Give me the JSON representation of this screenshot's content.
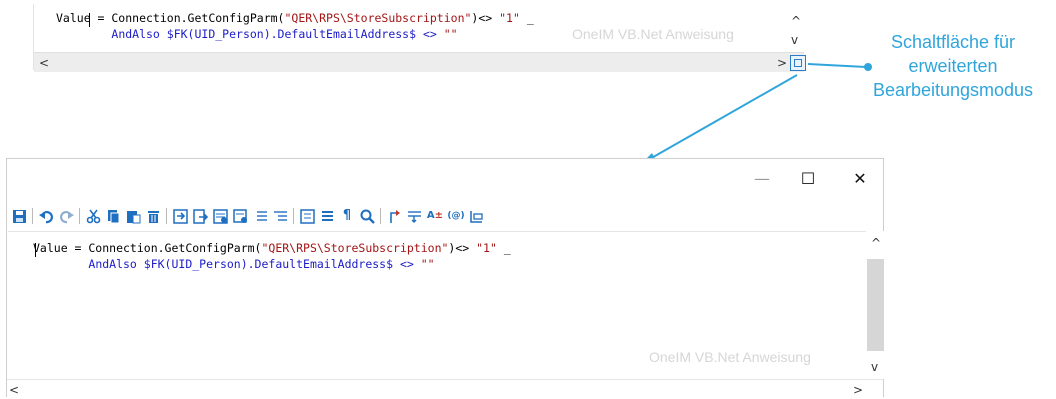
{
  "small_editor": {
    "line1": {
      "plain": "Value = Connection.GetConfigParm(",
      "string": "\"QER\\RPS\\StoreSubscription\"",
      "rest": ")<> ",
      "value": "\"1\"",
      "tail": " _"
    },
    "line2": {
      "indent": "        ",
      "keyword": "AndAlso",
      "expr": " $FK(UID_Person).DefaultEmailAddress$ <> ",
      "empty": "\"\""
    },
    "watermark": "OneIM VB.Net Anweisung",
    "scroll_up": "^",
    "scroll_down": "v",
    "scroll_left": "<",
    "scroll_right": ">"
  },
  "callout": {
    "lines": [
      "Schaltfläche für",
      "erweiterten",
      "Bearbeitungsmodus"
    ]
  },
  "large_window": {
    "title_buttons": {
      "minimize": "—",
      "maximize": "☐",
      "close": "✕"
    },
    "toolbar_icons": [
      "save-icon",
      "undo-icon",
      "redo-icon",
      "cut-icon",
      "copy-icon",
      "paste-icon",
      "delete-icon",
      "insert-icon",
      "export-icon",
      "format-icon",
      "format-selection-icon",
      "indent-icon",
      "outdent-icon",
      "list-icon",
      "align-icon",
      "paragraph-icon",
      "search-icon",
      "bookmark-icon",
      "wrap-icon",
      "font-size-icon",
      "special-char-icon",
      "settings-icon"
    ],
    "code": {
      "line1": {
        "plain": "Value = Connection.GetConfigParm(",
        "string": "\"QER\\RPS\\StoreSubscription\"",
        "rest": ")<> ",
        "value": "\"1\"",
        "tail": " _"
      },
      "line2": {
        "indent": "        ",
        "keyword": "AndAlso",
        "expr": " $FK(UID_Person).DefaultEmailAddress$ <> ",
        "empty": "\"\""
      }
    },
    "watermark": "OneIM VB.Net Anweisung",
    "scroll_up": "^",
    "scroll_down": "v",
    "scroll_left": "<",
    "scroll_right": ">"
  },
  "colors": {
    "accent": "#2fa5dc",
    "keyword": "#1c1cc8",
    "string": "#a31515",
    "toolbar_blue": "#1f6fc0",
    "toolbar_red": "#c0392b"
  }
}
